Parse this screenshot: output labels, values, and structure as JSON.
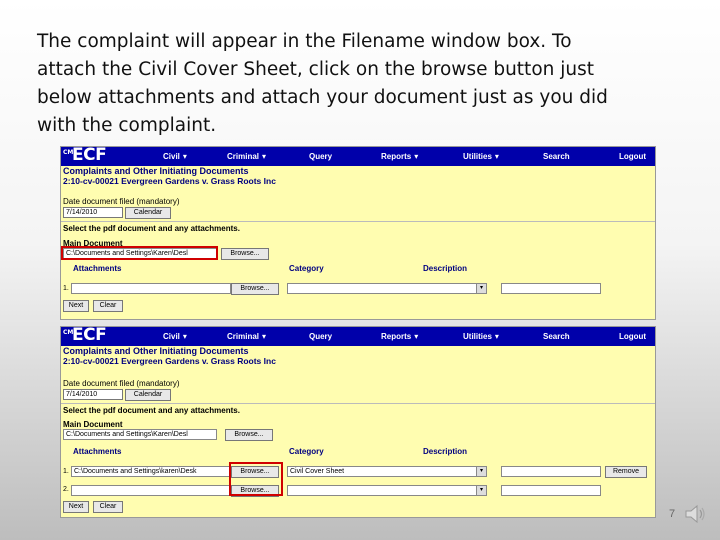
{
  "slide": {
    "text_lines": [
      "The complaint will appear in the Filename window box. To",
      "attach the Civil Cover Sheet, click on the browse button just",
      "below attachments and attach your document just as you did",
      "with the complaint."
    ],
    "page_number": "7"
  },
  "ecf_top": {
    "logo": "ECF",
    "logo_prefix": "CM",
    "menu": [
      "Civil",
      "Criminal",
      "Query",
      "Reports",
      "Utilities",
      "Search",
      "Logout"
    ],
    "heading_line1": "Complaints and Other Initiating Documents",
    "case_line": "2:10-cv-00021 Evergreen Gardens v. Grass Roots Inc",
    "date_label": "Date document filed (mandatory)",
    "date_value": "7/14/2010",
    "calendar_button": "Calendar",
    "select_label": "Select the pdf document and any attachments.",
    "main_doc_label": "Main Document",
    "main_doc_value": "C:\\Documents and Settings\\Karen\\Desl",
    "browse_button": "Browse...",
    "col_attachments": "Attachments",
    "col_category": "Category",
    "col_description": "Description",
    "row1_num": "1.",
    "next_button": "Next",
    "clear_button": "Clear"
  },
  "ecf_bottom": {
    "logo": "ECF",
    "logo_prefix": "CM",
    "menu": [
      "Civil",
      "Criminal",
      "Query",
      "Reports",
      "Utilities",
      "Search",
      "Logout"
    ],
    "heading_line1": "Complaints and Other Initiating Documents",
    "case_line": "2:10-cv-00021 Evergreen Gardens v. Grass Roots Inc",
    "date_label": "Date document filed (mandatory)",
    "date_value": "7/14/2010",
    "calendar_button": "Calendar",
    "select_label": "Select the pdf document and any attachments.",
    "main_doc_label": "Main Document",
    "main_doc_value": "C:\\Documents and Settings\\Karen\\Desl",
    "browse_button": "Browse...",
    "col_attachments": "Attachments",
    "col_category": "Category",
    "col_description": "Description",
    "row1_num": "1.",
    "row1_value": "C:\\Documents and Settings\\karen\\Desk",
    "row1_category": "Civil Cover Sheet",
    "remove_button": "Remove",
    "row2_num": "2.",
    "next_button": "Next",
    "clear_button": "Clear"
  },
  "colors": {
    "menubar": "#0000aa",
    "form_background": "#fffdb0",
    "highlight": "#d00000",
    "heading_text": "#000080"
  },
  "icons": [
    "speaker-icon",
    "dropdown-arrow-icon"
  ]
}
